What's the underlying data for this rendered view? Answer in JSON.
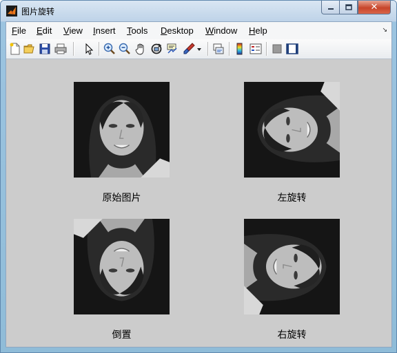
{
  "window": {
    "title": "图片旋转"
  },
  "menu": {
    "items": [
      {
        "mnemonic": "F",
        "rest": "ile"
      },
      {
        "mnemonic": "E",
        "rest": "dit"
      },
      {
        "mnemonic": "V",
        "rest": "iew"
      },
      {
        "mnemonic": "I",
        "rest": "nsert"
      },
      {
        "mnemonic": "T",
        "rest": "ools"
      },
      {
        "mnemonic": "D",
        "rest": "esktop"
      },
      {
        "mnemonic": "W",
        "rest": "indow"
      },
      {
        "mnemonic": "H",
        "rest": "elp"
      }
    ]
  },
  "toolbar": {
    "icons": [
      "new-figure-icon",
      "open-file-icon",
      "save-icon",
      "print-icon",
      "pointer-icon",
      "zoom-in-icon",
      "zoom-out-icon",
      "pan-hand-icon",
      "rotate-3d-icon",
      "data-cursor-icon",
      "brush-icon",
      "brush-dropdown-icon",
      "link-plot-icon",
      "colorbar-icon",
      "legend-icon",
      "hide-plot-tools-icon",
      "show-plot-tools-icon"
    ]
  },
  "figure": {
    "panels": [
      {
        "caption": "原始图片"
      },
      {
        "caption": "左旋转"
      },
      {
        "caption": "倒置"
      },
      {
        "caption": "右旋转"
      }
    ]
  }
}
